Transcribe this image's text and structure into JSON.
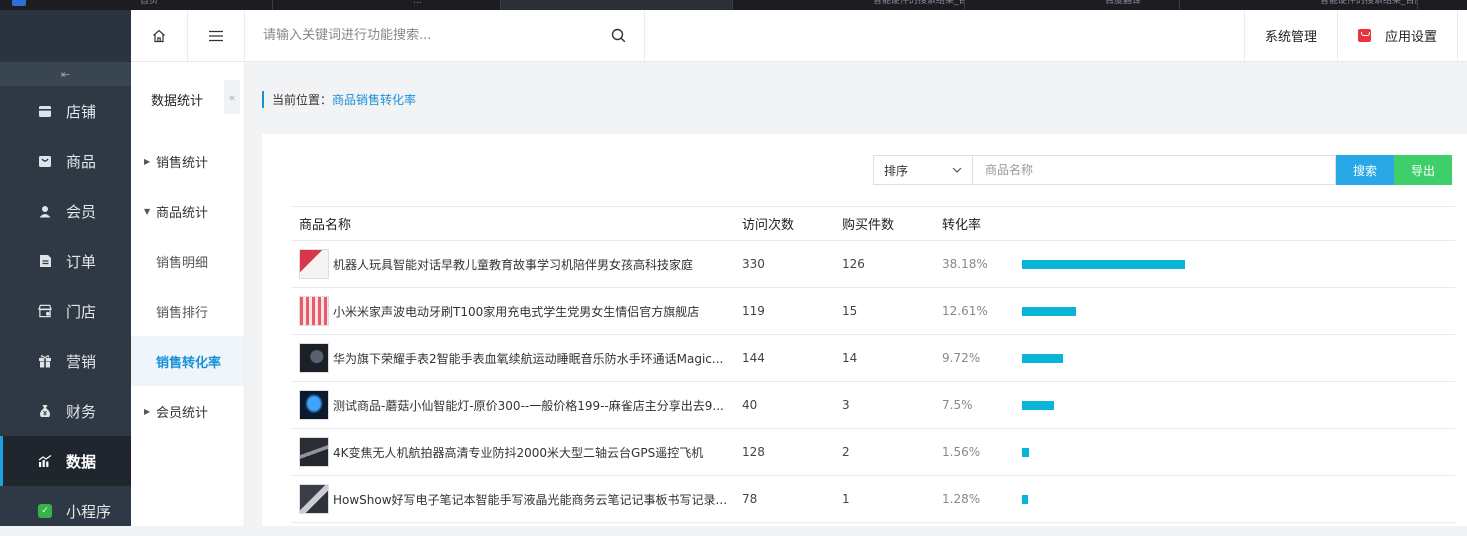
{
  "colors": {
    "accent": "#1890d8",
    "bar": "#0ab4d8",
    "sidebar_bg": "#2f3945",
    "search_btn": "#29a8e8",
    "export_btn": "#3fcf6a"
  },
  "browser_tabs": [
    "首页",
    "...",
    "",
    "智能硬件的搜索结果_百度图片搜索",
    "百度翻译",
    "智能硬件的搜索结果_百度图片搜索",
    ""
  ],
  "sidebar": {
    "items": [
      {
        "label": "店铺",
        "icon": "store-icon"
      },
      {
        "label": "商品",
        "icon": "goods-icon"
      },
      {
        "label": "会员",
        "icon": "user-icon"
      },
      {
        "label": "订单",
        "icon": "order-icon"
      },
      {
        "label": "门店",
        "icon": "shop-icon"
      },
      {
        "label": "营销",
        "icon": "gift-icon"
      },
      {
        "label": "财务",
        "icon": "money-bag-icon"
      },
      {
        "label": "数据",
        "icon": "chart-icon",
        "active": true
      },
      {
        "label": "小程序",
        "icon": "miniapp-icon"
      }
    ],
    "collapse_glyph": "⇤"
  },
  "topbar": {
    "search_placeholder": "请输入关键词进行功能搜索...",
    "system_label": "系统管理",
    "app_settings_label": "应用设置"
  },
  "subnav": {
    "title": "数据统计",
    "fold_glyph": "«",
    "items": [
      {
        "label": "销售统计",
        "type": "group"
      },
      {
        "label": "商品统计",
        "type": "group",
        "expanded": true
      },
      {
        "label": "销售明细",
        "type": "child"
      },
      {
        "label": "销售排行",
        "type": "child"
      },
      {
        "label": "销售转化率",
        "type": "child",
        "active": true
      },
      {
        "label": "会员统计",
        "type": "group"
      }
    ]
  },
  "breadcrumb": {
    "prefix": "当前位置：",
    "current": "商品销售转化率"
  },
  "filter": {
    "sort_label": "排序",
    "name_placeholder": "商品名称",
    "search_label": "搜索",
    "export_label": "导出"
  },
  "table": {
    "headers": [
      "商品名称",
      "访问次数",
      "购买件数",
      "转化率"
    ],
    "rows": [
      {
        "name": "机器人玩具智能对话早教儿童教育故事学习机陪伴男女孩高科技家庭",
        "visits": "330",
        "purchases": "126",
        "rate": "38.18%",
        "rate_value": 38.18,
        "thumb": "robot"
      },
      {
        "name": "小米米家声波电动牙刷T100家用充电式学生党男女生情侣官方旗舰店",
        "visits": "119",
        "purchases": "15",
        "rate": "12.61%",
        "rate_value": 12.61,
        "thumb": "toothbrush"
      },
      {
        "name": "华为旗下荣耀手表2智能手表血氧续航运动睡眠音乐防水手环通话Magic...",
        "visits": "144",
        "purchases": "14",
        "rate": "9.72%",
        "rate_value": 9.72,
        "thumb": "watch"
      },
      {
        "name": "测试商品-蘑菇小仙智能灯-原价300--一般价格199--麻雀店主分享出去9...",
        "visits": "40",
        "purchases": "3",
        "rate": "7.5%",
        "rate_value": 7.5,
        "thumb": "lamp"
      },
      {
        "name": "4K变焦无人机航拍器高清专业防抖2000米大型二轴云台GPS遥控飞机",
        "visits": "128",
        "purchases": "2",
        "rate": "1.56%",
        "rate_value": 1.56,
        "thumb": "drone"
      },
      {
        "name": "HowShow好写电子笔记本智能手写液晶光能商务云笔记记事板书写记录...",
        "visits": "78",
        "purchases": "1",
        "rate": "1.28%",
        "rate_value": 1.28,
        "thumb": "notebook"
      }
    ]
  }
}
